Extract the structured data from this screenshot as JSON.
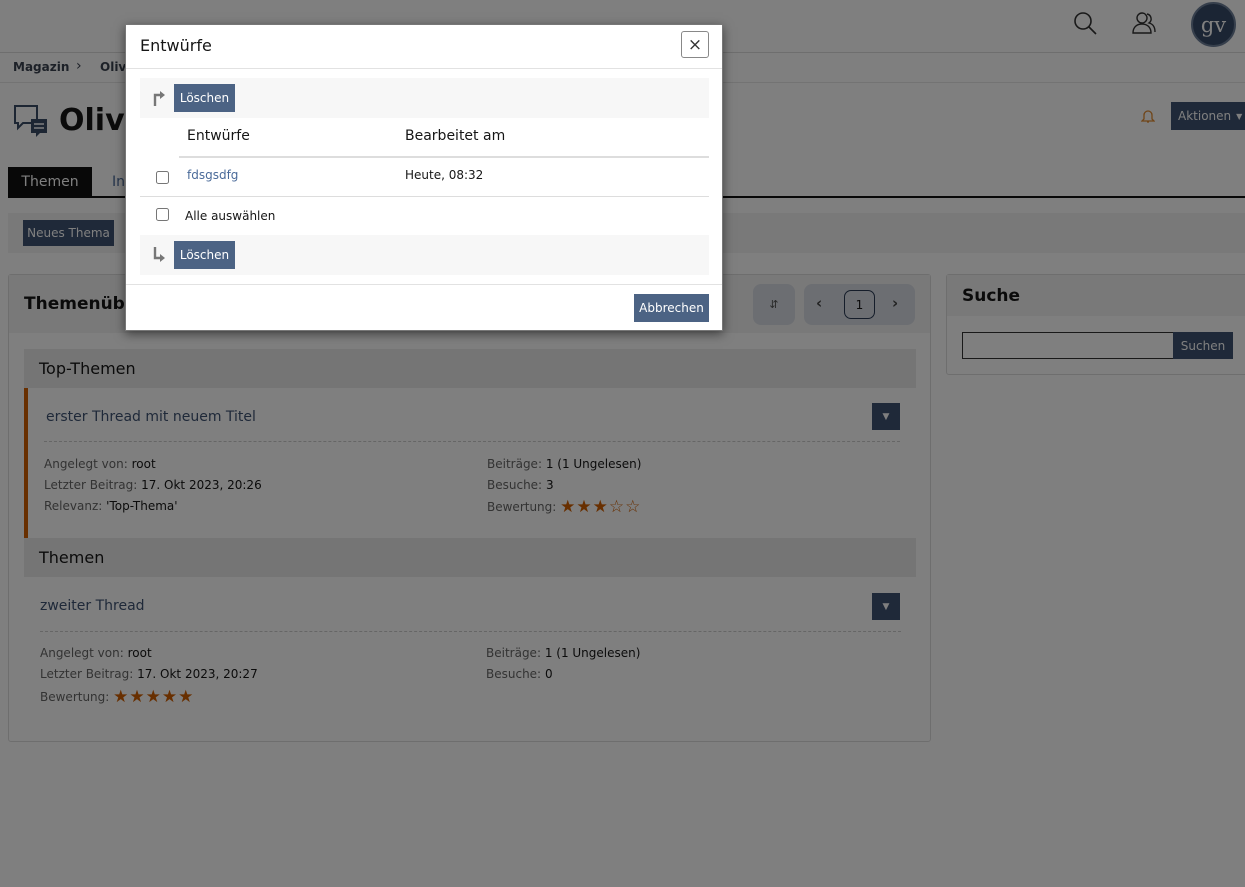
{
  "header": {
    "avatar_initials": "gv",
    "icons": [
      "search-icon",
      "users-icon"
    ]
  },
  "breadcrumb": {
    "items": [
      "Magazin",
      "Olive"
    ]
  },
  "page": {
    "title": "Olive",
    "actions_label": "Aktionen"
  },
  "tabs": [
    {
      "label": "Themen",
      "active": true
    },
    {
      "label": "In"
    }
  ],
  "toolbar": {
    "new_topic_label": "Neues Thema"
  },
  "topics_panel": {
    "title": "Themenübersicht",
    "current_page": "1",
    "top_section": "Top-Themen",
    "section": "Themen",
    "top_topics": [
      {
        "title": "erster Thread mit neuem Titel",
        "created_by_label": "Angelegt von:",
        "created_by": "root",
        "last_post_label": "Letzter Beitrag:",
        "last_post": "17. Okt 2023, 20:26",
        "relevance_label": "Relevanz:",
        "relevance": "'Top-Thema'",
        "posts_label": "Beiträge:",
        "posts": "1 (1 Ungelesen)",
        "visits_label": "Besuche:",
        "visits": "3",
        "rating_label": "Bewertung:",
        "rating": 3
      }
    ],
    "topics": [
      {
        "title": "zweiter Thread",
        "created_by_label": "Angelegt von:",
        "created_by": "root",
        "last_post_label": "Letzter Beitrag:",
        "last_post": "17. Okt 2023, 20:27",
        "posts_label": "Beiträge:",
        "posts": "1 (1 Ungelesen)",
        "visits_label": "Besuche:",
        "visits": "0",
        "rating_label": "Bewertung:",
        "rating": 5
      }
    ]
  },
  "search_panel": {
    "title": "Suche",
    "input_value": "",
    "button_label": "Suchen"
  },
  "modal": {
    "title": "Entwürfe",
    "delete_label": "Löschen",
    "col_drafts": "Entwürfe",
    "col_edited": "Bearbeitet am",
    "rows": [
      {
        "name": "fdsgsdfg",
        "edited": "Heute, 08:32",
        "checked": false
      }
    ],
    "select_all_label": "Alle auswählen",
    "cancel_label": "Abbrechen",
    "close_label": "×"
  },
  "colors": {
    "button": "#4c6384",
    "accent_orange": "#d05e00",
    "link": "#4a6a99"
  }
}
